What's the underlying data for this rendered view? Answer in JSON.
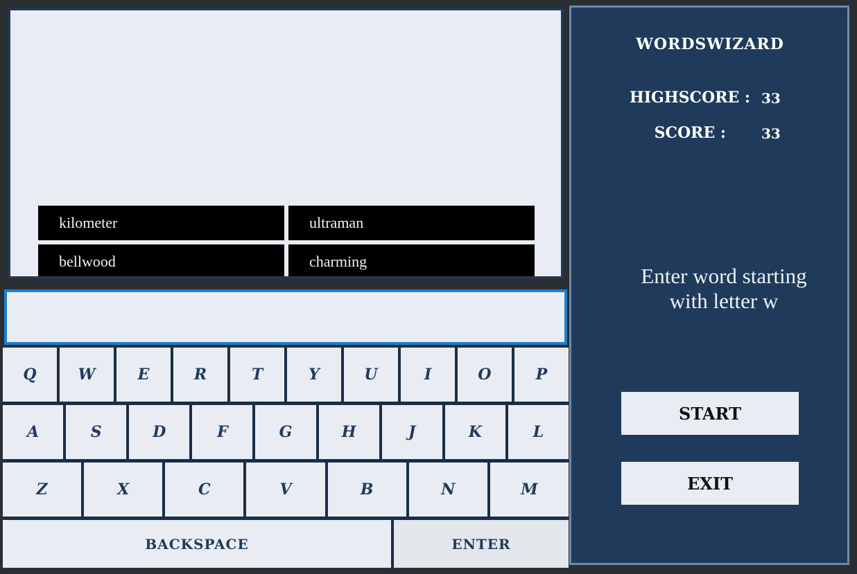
{
  "game": {
    "title": "WORDSWIZARD",
    "highscore_label": "HIGHSCORE :",
    "highscore_value": "33",
    "score_label": "SCORE :",
    "score_value": "33",
    "prompt_line1": "Enter word starting",
    "prompt_line2": "with letter w"
  },
  "words": [
    "kilometer",
    "ultraman",
    "bellwood",
    "charming"
  ],
  "input": {
    "value": ""
  },
  "keyboard": {
    "row1": [
      "Q",
      "W",
      "E",
      "R",
      "T",
      "Y",
      "U",
      "I",
      "O",
      "P"
    ],
    "row2": [
      "A",
      "S",
      "D",
      "F",
      "G",
      "H",
      "J",
      "K",
      "L"
    ],
    "row3": [
      "Z",
      "X",
      "C",
      "V",
      "B",
      "N",
      "M"
    ],
    "backspace_label": "BACKSPACE",
    "enter_label": "ENTER"
  },
  "buttons": {
    "start_label": "START",
    "exit_label": "EXIT"
  },
  "colors": {
    "panel_bg": "#1f3a5a",
    "input_border": "#1e7fd0",
    "word_cell_bg": "#000000",
    "key_bg": "#e9edf3"
  }
}
